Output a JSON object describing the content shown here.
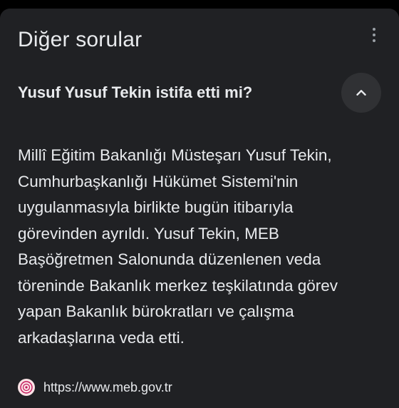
{
  "section": {
    "title": "Diğer sorular",
    "menu_icon": "more-vert-icon"
  },
  "question": {
    "text": "Yusuf Yusuf Tekin istifa etti mi?",
    "toggle_icon": "chevron-up-icon",
    "expanded": true
  },
  "answer": {
    "text": "Millî Eğitim Bakanlığı Müsteşarı Yusuf Tekin, Cumhurbaşkanlığı Hükümet Sistemi'nin uygulanmasıyla birlikte bugün itibarıyla görevinden ayrıldı. Yusuf Tekin, MEB Başöğretmen Salonunda düzenlenen veda töreninde Bakanlık merkez teşkilatında görev yapan Bakanlık bürokratları ve çalışma arkadaşlarına veda etti."
  },
  "source": {
    "url": "https://www.meb.gov.tr",
    "favicon": "meb-logo-icon"
  },
  "colors": {
    "background": "#000000",
    "card": "#202124",
    "text": "#e8eaed",
    "button": "#303134",
    "icon": "#9aa0a6"
  }
}
